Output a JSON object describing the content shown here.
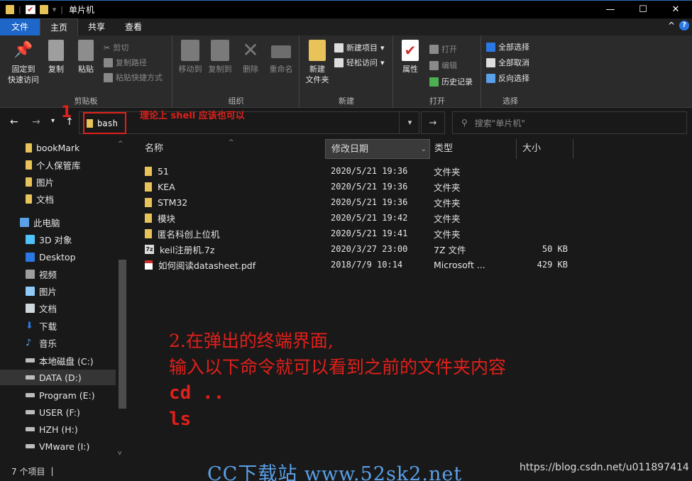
{
  "window": {
    "title": "单片机",
    "min": "—",
    "max": "☐",
    "close": "✕"
  },
  "tabs": [
    "文件",
    "主页",
    "共享",
    "查看"
  ],
  "ribbon": {
    "clipboard": {
      "pin": "固定到\n快速访问",
      "copy": "复制",
      "paste": "粘贴",
      "cut": "剪切",
      "copy_path": "复制路径",
      "paste_shortcut": "粘贴快捷方式",
      "label": "剪贴板"
    },
    "organize": {
      "move_to": "移动到",
      "copy_to": "复制到",
      "delete": "删除",
      "rename": "重命名",
      "label": "组织"
    },
    "new": {
      "new_folder": "新建\n文件夹",
      "new_item": "新建项目",
      "easy_access": "轻松访问",
      "label": "新建"
    },
    "open": {
      "properties": "属性",
      "open": "打开",
      "edit": "编辑",
      "history": "历史记录",
      "label": "打开"
    },
    "select": {
      "select_all": "全部选择",
      "select_none": "全部取消",
      "invert": "反向选择",
      "label": "选择"
    }
  },
  "address": {
    "path": "bash",
    "search_placeholder": "搜索\"单片机\"",
    "annotation_num": "1",
    "annotation_text": "理论上 shell 应该也可以"
  },
  "nav": {
    "items": [
      {
        "label": "bookMark",
        "icon": "folder-icon",
        "color": "#e8c35a"
      },
      {
        "label": "个人保管库",
        "icon": "vault-icon",
        "color": "#e8c35a"
      },
      {
        "label": "图片",
        "icon": "folder-icon",
        "color": "#e8c35a"
      },
      {
        "label": "文档",
        "icon": "folder-icon",
        "color": "#e8c35a"
      },
      {
        "label": "此电脑",
        "icon": "computer-icon",
        "color": "#5aa0e8"
      },
      {
        "label": "3D 对象",
        "icon": "cube-icon",
        "color": "#4fc3f7"
      },
      {
        "label": "Desktop",
        "icon": "desktop-icon",
        "color": "#2b78e4"
      },
      {
        "label": "视频",
        "icon": "video-icon",
        "color": "#9e9e9e"
      },
      {
        "label": "图片",
        "icon": "pictures-icon",
        "color": "#90caf9"
      },
      {
        "label": "文档",
        "icon": "documents-icon",
        "color": "#cfd8dc"
      },
      {
        "label": "下载",
        "icon": "download-icon",
        "color": "#2b78e4"
      },
      {
        "label": "音乐",
        "icon": "music-icon",
        "color": "#5aa0e8"
      },
      {
        "label": "本地磁盘 (C:)",
        "icon": "drive-icon",
        "color": "#bdbdbd"
      },
      {
        "label": "DATA (D:)",
        "icon": "drive-icon",
        "color": "#bdbdbd"
      },
      {
        "label": "Program (E:)",
        "icon": "drive-icon",
        "color": "#bdbdbd"
      },
      {
        "label": "USER (F:)",
        "icon": "drive-icon",
        "color": "#bdbdbd"
      },
      {
        "label": "HZH (H:)",
        "icon": "drive-icon",
        "color": "#bdbdbd"
      },
      {
        "label": "VMware (I:)",
        "icon": "drive-icon",
        "color": "#bdbdbd"
      }
    ]
  },
  "columns": {
    "name": "名称",
    "date": "修改日期",
    "type": "类型",
    "size": "大小"
  },
  "files": [
    {
      "name": "51",
      "date": "2020/5/21 19:36",
      "type": "文件夹",
      "size": "",
      "icon": "folder-icon"
    },
    {
      "name": "KEA",
      "date": "2020/5/21 19:36",
      "type": "文件夹",
      "size": "",
      "icon": "folder-icon"
    },
    {
      "name": "STM32",
      "date": "2020/5/21 19:36",
      "type": "文件夹",
      "size": "",
      "icon": "folder-icon"
    },
    {
      "name": "模块",
      "date": "2020/5/21 19:42",
      "type": "文件夹",
      "size": "",
      "icon": "folder-icon"
    },
    {
      "name": "匿名科创上位机",
      "date": "2020/5/21 19:41",
      "type": "文件夹",
      "size": "",
      "icon": "folder-icon"
    },
    {
      "name": "keil注册机.7z",
      "date": "2020/3/27 23:00",
      "type": "7Z 文件",
      "size": "50 KB",
      "icon": "archive-icon"
    },
    {
      "name": "如何阅读datasheet.pdf",
      "date": "2018/7/9 10:14",
      "type": "Microsoft ...",
      "size": "429 KB",
      "icon": "pdf-icon"
    }
  ],
  "annotation2": {
    "line1": "2.在弹出的终端界面,",
    "line2": "输入以下命令就可以看到之前的文件夹内容",
    "line3": "cd ..",
    "line4": "ls"
  },
  "status": {
    "count": "7 个项目",
    "sep": "|"
  },
  "watermark": "CC下载站 www.52sk2.net",
  "url": "https://blog.csdn.net/u011897414"
}
